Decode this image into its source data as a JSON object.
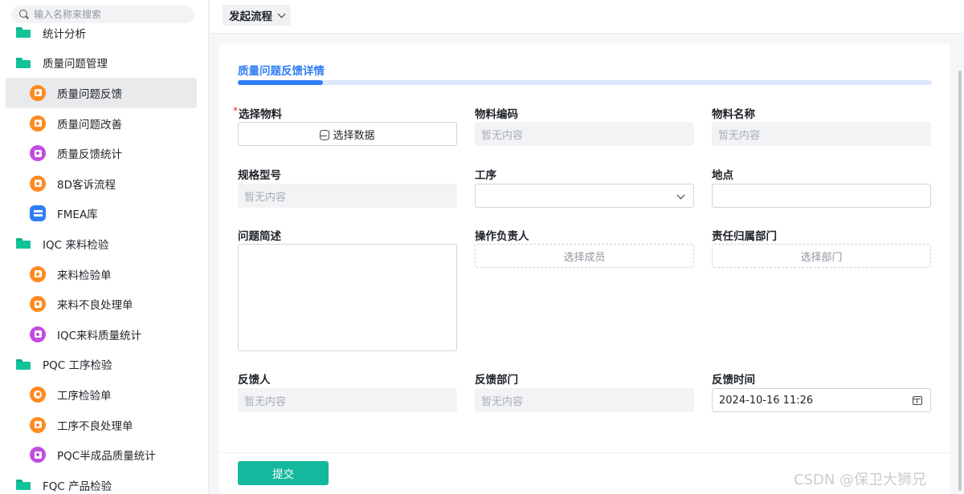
{
  "search": {
    "placeholder": "输入名称来搜索"
  },
  "sidebar": {
    "items": [
      {
        "type": "group",
        "label": "统计分析"
      },
      {
        "type": "group",
        "label": "质量问题管理"
      },
      {
        "type": "leaf",
        "label": "质量问题反馈",
        "icon": "feedback-icon",
        "color": "#ff8a1f",
        "active": true
      },
      {
        "type": "leaf",
        "label": "质量问题改善",
        "icon": "improve-icon",
        "color": "#ff8a1f"
      },
      {
        "type": "leaf",
        "label": "质量反馈统计",
        "icon": "chart-icon",
        "color": "#c14de0"
      },
      {
        "type": "leaf",
        "label": "8D客诉流程",
        "icon": "process-icon",
        "color": "#ff8a1f"
      },
      {
        "type": "leaf",
        "label": "FMEA库",
        "icon": "library-icon",
        "color": "#2f7ef5"
      },
      {
        "type": "group",
        "label": "IQC 来料检验"
      },
      {
        "type": "leaf",
        "label": "来料检验单",
        "icon": "truck-icon",
        "color": "#ff8a1f"
      },
      {
        "type": "leaf",
        "label": "来料不良处理单",
        "icon": "defect-icon",
        "color": "#ff8a1f"
      },
      {
        "type": "leaf",
        "label": "IQC来料质量统计",
        "icon": "chart-icon",
        "color": "#c14de0"
      },
      {
        "type": "group",
        "label": "PQC 工序检验"
      },
      {
        "type": "leaf",
        "label": "工序检验单",
        "icon": "gear-icon",
        "color": "#ff8a1f"
      },
      {
        "type": "leaf",
        "label": "工序不良处理单",
        "icon": "defect-icon",
        "color": "#ff8a1f"
      },
      {
        "type": "leaf",
        "label": "PQC半成品质量统计",
        "icon": "chart-icon",
        "color": "#c14de0"
      },
      {
        "type": "group",
        "label": "FQC 产品检验"
      }
    ]
  },
  "topbar": {
    "flow_button": "发起流程"
  },
  "form": {
    "tab_title": "质量问题反馈详情",
    "required_mark": "*",
    "material": {
      "label": "选择物料",
      "button": "选择数据"
    },
    "material_code": {
      "label": "物料编码",
      "value": "暂无内容"
    },
    "material_name": {
      "label": "物料名称",
      "value": "暂无内容"
    },
    "spec": {
      "label": "规格型号",
      "value": "暂无内容"
    },
    "process": {
      "label": "工序",
      "value": ""
    },
    "location": {
      "label": "地点",
      "value": ""
    },
    "description": {
      "label": "问题简述",
      "value": ""
    },
    "owner": {
      "label": "操作负责人",
      "button": "选择成员"
    },
    "department": {
      "label": "责任归属部门",
      "button": "选择部门"
    },
    "reporter": {
      "label": "反馈人",
      "value": "暂无内容"
    },
    "reporter_dept": {
      "label": "反馈部门",
      "value": "暂无内容"
    },
    "report_time": {
      "label": "反馈时间",
      "value": "2024-10-16 11:26"
    },
    "submit": "提交"
  },
  "watermark": "CSDN @保卫大狮兄",
  "colors": {
    "accent": "#2f7ef5",
    "submit": "#14b89c",
    "folder": "#12c39a"
  }
}
